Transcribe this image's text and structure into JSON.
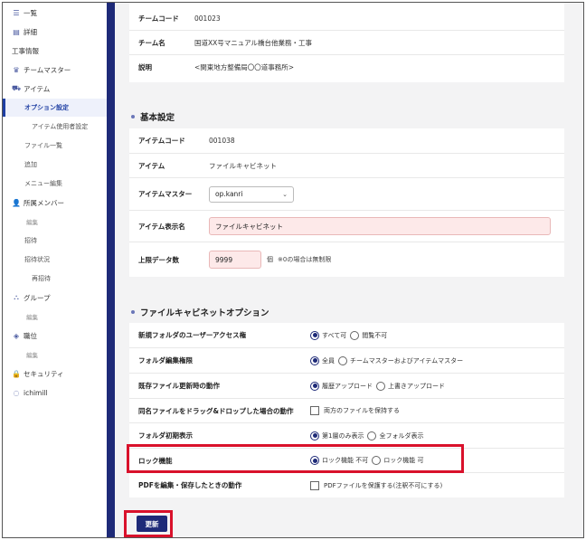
{
  "sidebar": {
    "items": [
      {
        "label": "一覧",
        "icon": "list-icon",
        "level": 0,
        "glyph": "☰"
      },
      {
        "label": "詳細",
        "icon": "document-icon",
        "level": 0,
        "glyph": "▤"
      },
      {
        "label": "工事情報",
        "icon": "",
        "level": 0,
        "glyph": ""
      },
      {
        "label": "チームマスター",
        "icon": "crown-icon",
        "level": 0,
        "glyph": "♛"
      },
      {
        "label": "アイテム",
        "icon": "box-icon",
        "level": 0,
        "glyph": "⛟"
      },
      {
        "label": "オプション設定",
        "icon": "",
        "level": 1,
        "glyph": "",
        "active": true
      },
      {
        "label": "アイテム使用者設定",
        "icon": "",
        "level": 2,
        "glyph": ""
      },
      {
        "label": "ファイル一覧",
        "icon": "",
        "level": 1,
        "glyph": ""
      },
      {
        "label": "追加",
        "icon": "",
        "level": 1,
        "glyph": ""
      },
      {
        "label": "メニュー編集",
        "icon": "",
        "level": 1,
        "glyph": ""
      },
      {
        "label": "所属メンバー",
        "icon": "user-icon",
        "level": 0,
        "glyph": "👤"
      },
      {
        "label": "編集",
        "icon": "",
        "level": 3,
        "glyph": ""
      },
      {
        "label": "招待",
        "icon": "",
        "level": 1,
        "glyph": ""
      },
      {
        "label": "招待状況",
        "icon": "",
        "level": 1,
        "glyph": ""
      },
      {
        "label": "再招待",
        "icon": "",
        "level": 2,
        "glyph": ""
      },
      {
        "label": "グループ",
        "icon": "group-icon",
        "level": 0,
        "glyph": "⛬"
      },
      {
        "label": "編集",
        "icon": "",
        "level": 3,
        "glyph": ""
      },
      {
        "label": "職位",
        "icon": "layers-icon",
        "level": 0,
        "glyph": "◈"
      },
      {
        "label": "編集",
        "icon": "",
        "level": 3,
        "glyph": ""
      },
      {
        "label": "セキュリティ",
        "icon": "lock-icon",
        "level": 0,
        "glyph": "🔒"
      },
      {
        "label": "ichimill",
        "icon": "ichimill-icon",
        "level": 0,
        "glyph": "◌"
      }
    ]
  },
  "team": {
    "rows": [
      {
        "label": "チームコード",
        "value": "001023"
      },
      {
        "label": "チーム名",
        "value": "国道XX号マニュアル橋台他業務・工事"
      },
      {
        "label": "説明",
        "value": "<関東地方整備局〇〇道事務所>"
      }
    ]
  },
  "basic": {
    "title": "基本設定",
    "item_code_label": "アイテムコード",
    "item_code": "001038",
    "item_label": "アイテム",
    "item": "ファイルキャビネット",
    "master_label": "アイテムマスター",
    "master_value": "op.kanri",
    "display_name_label": "アイテム表示名",
    "display_name": "ファイルキャビネット",
    "limit_label": "上限データ数",
    "limit_value": "9999",
    "limit_unit": "個",
    "limit_note": "※0の場合は無制限"
  },
  "options": {
    "title": "ファイルキャビネットオプション",
    "rows": [
      {
        "label": "新規フォルダのユーザーアクセス権",
        "type": "radio",
        "choices": [
          "すべて可",
          "閲覧不可"
        ],
        "selected": 0
      },
      {
        "label": "フォルダ編集権限",
        "type": "radio",
        "choices": [
          "全員",
          "チームマスターおよびアイテムマスター"
        ],
        "selected": 0
      },
      {
        "label": "既存ファイル更新時の動作",
        "type": "radio",
        "choices": [
          "履歴アップロード",
          "上書きアップロード"
        ],
        "selected": 0
      },
      {
        "label": "同名ファイルをドラッグ&ドロップした場合の動作",
        "type": "check",
        "choices": [
          "両方のファイルを保持する"
        ],
        "selected": -1
      },
      {
        "label": "フォルダ初期表示",
        "type": "radio",
        "choices": [
          "第1層のみ表示",
          "全フォルダ表示"
        ],
        "selected": 0
      },
      {
        "label": "ロック機能",
        "type": "radio",
        "choices": [
          "ロック機能 不可",
          "ロック機能 可"
        ],
        "selected": 0
      },
      {
        "label": "PDFを編集・保存したときの動作",
        "type": "check",
        "choices": [
          "PDFファイルを保護する(注釈不可にする)"
        ],
        "selected": -1
      }
    ]
  },
  "actions": {
    "update_label": "更新"
  },
  "colors": {
    "accent": "#1e2a78",
    "highlight": "#d9112b",
    "input_pink": "#fde9e9"
  }
}
